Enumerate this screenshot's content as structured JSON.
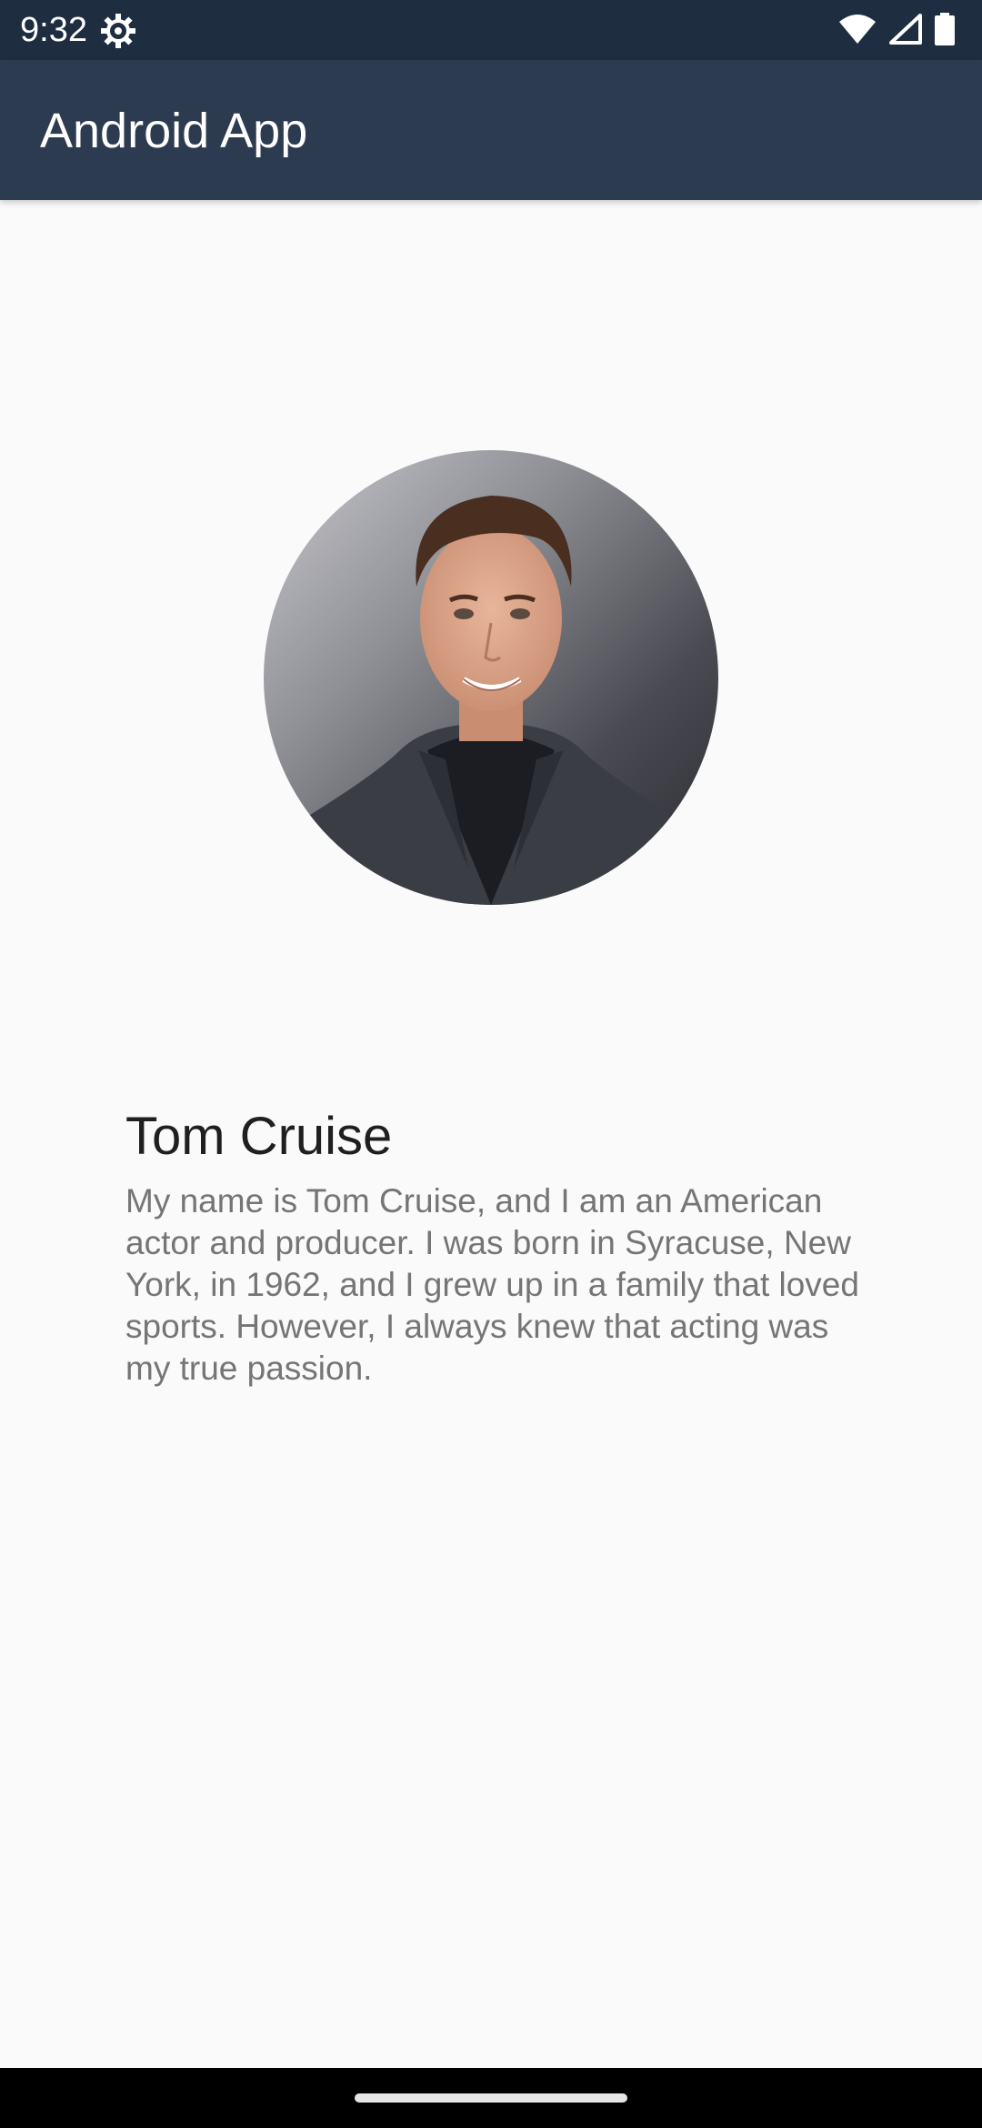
{
  "status_bar": {
    "time": "9:32",
    "icons": [
      "settings-gear-icon",
      "wifi-icon",
      "cellular-signal-icon",
      "battery-icon"
    ]
  },
  "app_bar": {
    "title": "Android App",
    "color": "#2c3b50"
  },
  "profile": {
    "name": "Tom Cruise",
    "bio": "My name is Tom Cruise, and I am an American actor and producer. I was born in Syracuse, New York, in 1962, and I grew up in a family that loved sports. However, I always knew that acting was my true passion."
  },
  "colors": {
    "status_bar": "#1e2d40",
    "background": "#fafafa",
    "name_text": "#1f1f1f",
    "bio_text": "#757575"
  }
}
